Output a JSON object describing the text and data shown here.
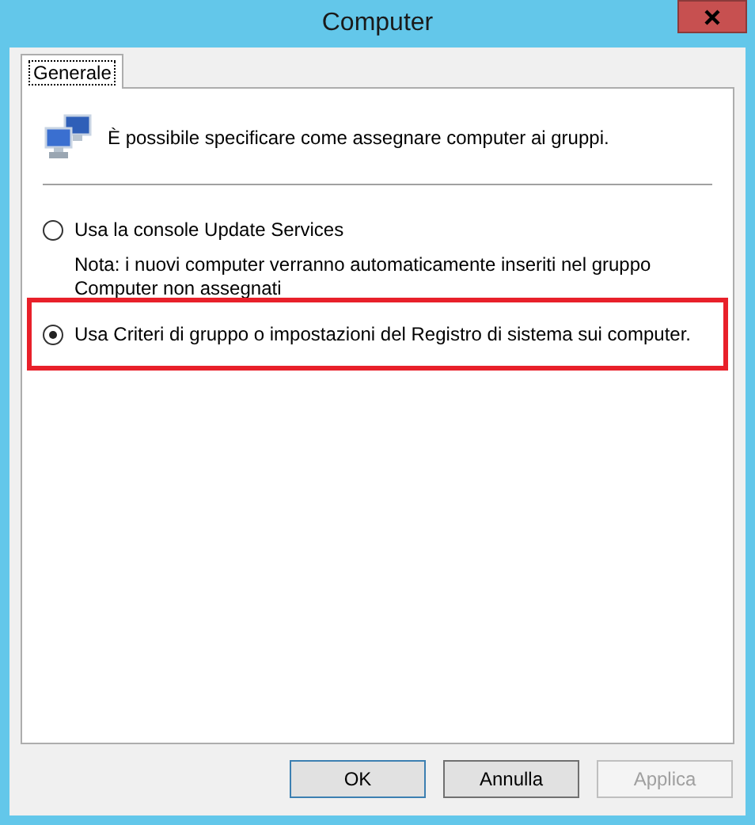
{
  "window": {
    "title": "Computer"
  },
  "tabs": [
    {
      "label": "Generale",
      "selected": true
    }
  ],
  "intro": "È possibile specificare come assegnare computer ai gruppi.",
  "options": [
    {
      "label": "Usa la console Update Services",
      "selected": false,
      "highlighted": false,
      "note": "Nota: i nuovi computer verranno automaticamente inseriti nel gruppo Computer non assegnati"
    },
    {
      "label": "Usa Criteri di gruppo o impostazioni del Registro di sistema sui computer.",
      "selected": true,
      "highlighted": true
    }
  ],
  "buttons": [
    {
      "label": "OK",
      "default": true,
      "disabled": false
    },
    {
      "label": "Annulla",
      "default": false,
      "disabled": false
    },
    {
      "label": "Applica",
      "default": false,
      "disabled": true
    }
  ]
}
